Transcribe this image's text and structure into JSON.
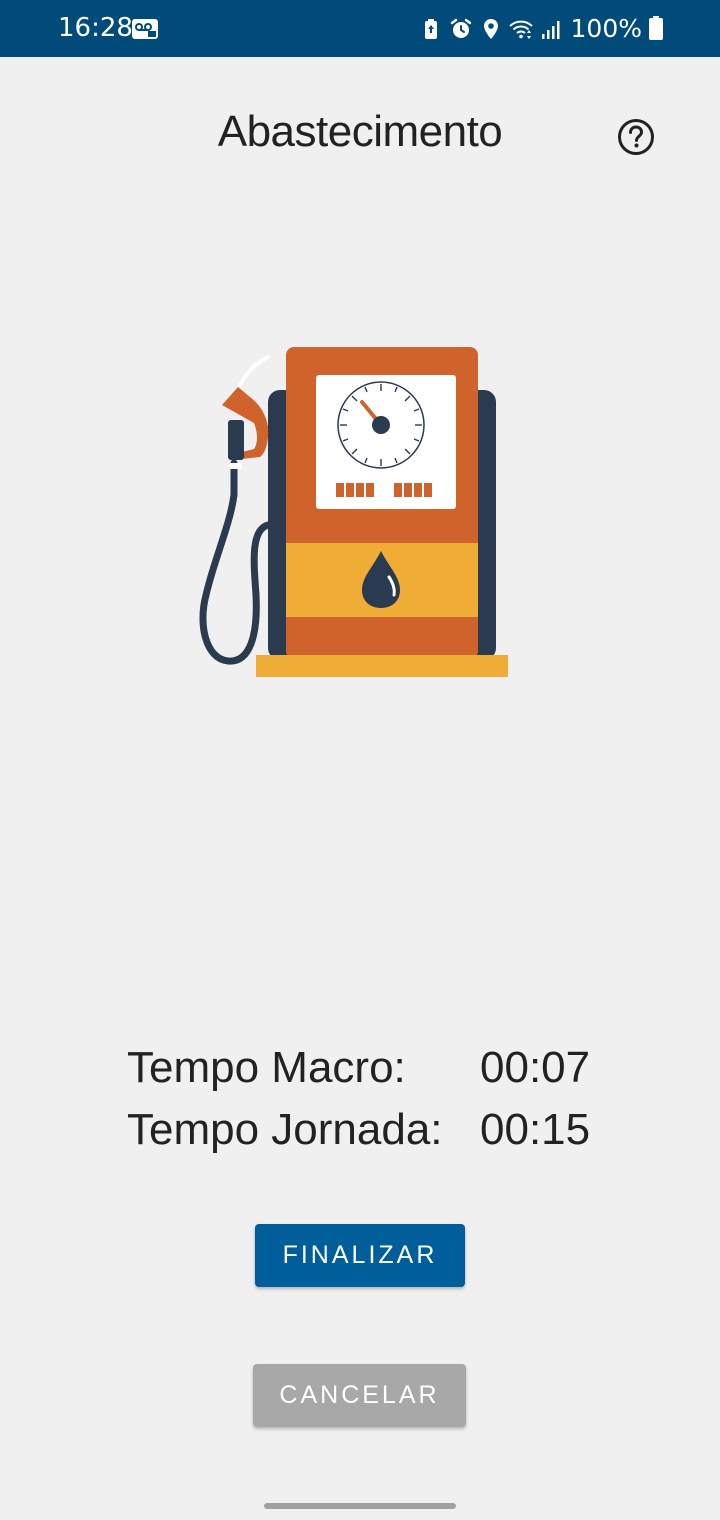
{
  "status_bar": {
    "time": "16:28",
    "battery": "100%",
    "icons": [
      "voicemail-icon",
      "battery-saver-icon",
      "alarm-icon",
      "location-icon",
      "wifi-icon",
      "signal-icon",
      "battery-icon"
    ]
  },
  "header": {
    "title": "Abastecimento",
    "help_icon": "question-circle-icon"
  },
  "illustration": {
    "name": "fuel-pump-illustration",
    "colors": {
      "orange": "#d0632b",
      "yellow": "#f0ad35",
      "navy": "#2a3a4f",
      "white": "#ffffff"
    }
  },
  "timers": {
    "macro_label": "Tempo Macro:",
    "macro_value": "00:07",
    "jornada_label": "Tempo Jornada:",
    "jornada_value": "00:15"
  },
  "actions": {
    "finalizar_label": "FINALIZAR",
    "cancelar_label": "CANCELAR"
  },
  "colors": {
    "status_bar": "#004b7a",
    "primary_button": "#005f9b",
    "secondary_button": "#a8a8a8",
    "background": "#f0f0f0"
  }
}
